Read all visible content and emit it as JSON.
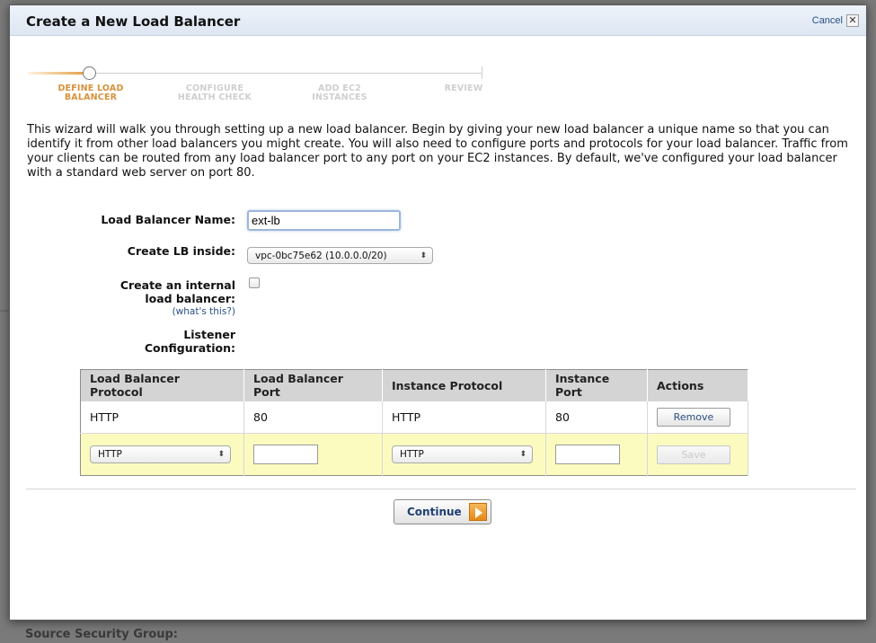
{
  "dialog": {
    "title": "Create a New Load Balancer",
    "cancel_label": "Cancel",
    "close_glyph": "✕"
  },
  "wizard": {
    "steps": [
      {
        "label_line1": "DEFINE LOAD",
        "label_line2": "BALANCER",
        "active": true
      },
      {
        "label_line1": "CONFIGURE",
        "label_line2": "HEALTH CHECK",
        "active": false
      },
      {
        "label_line1": "ADD EC2",
        "label_line2": "INSTANCES",
        "active": false
      },
      {
        "label_line1": "REVIEW",
        "label_line2": "",
        "active": false
      }
    ]
  },
  "intro_text": "This wizard will walk you through setting up a new load balancer. Begin by giving your new load balancer a unique name so that you can identify it from other load balancers you might create. You will also need to configure ports and protocols for your load balancer. Traffic from your clients can be routed from any load balancer port to any port on your EC2 instances. By default, we've configured your load balancer with a standard web server on port 80.",
  "form": {
    "name_label": "Load Balancer Name:",
    "name_value": "ext-lb",
    "create_inside_label": "Create LB inside:",
    "create_inside_value": "vpc-0bc75e62 (10.0.0.0/20)",
    "internal_label_line1": "Create an internal",
    "internal_label_line2": "load balancer:",
    "internal_help": "(what's this?)",
    "internal_checked": false,
    "listener_label_line1": "Listener",
    "listener_label_line2": "Configuration:"
  },
  "listener_table": {
    "headers": [
      "Load Balancer Protocol",
      "Load Balancer Port",
      "Instance Protocol",
      "Instance Port",
      "Actions"
    ],
    "rows": [
      {
        "lb_protocol": "HTTP",
        "lb_port": "80",
        "instance_protocol": "HTTP",
        "instance_port": "80",
        "action": "Remove"
      }
    ],
    "new_row": {
      "lb_protocol": "HTTP",
      "lb_port": "",
      "instance_protocol": "HTTP",
      "instance_port": "",
      "action": "Save"
    }
  },
  "footer": {
    "continue_label": "Continue"
  },
  "background": {
    "source_security_group_label": "Source Security Group:"
  },
  "colors": {
    "accent": "#d8913b",
    "link": "#2a4f86",
    "new_row_bg": "#fbfbbf"
  }
}
